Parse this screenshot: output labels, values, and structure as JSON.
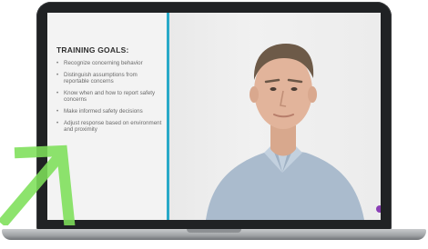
{
  "slide": {
    "title": "TRAINING GOALS:",
    "goals": [
      "Recognize concerning behavior",
      "Distinguish assumptions from reportable concerns",
      "Know when and how to report safety concerns",
      "Make informed safety decisions",
      "Adjust response based on environment and proximity"
    ]
  },
  "video": {
    "subject": "presenter"
  },
  "annotation": {
    "arrow_icon": "arrow-icon",
    "arrow_color": "#7ee05a"
  },
  "colors": {
    "divider": "#29a9c8",
    "laptop_frame": "#202224",
    "shirt": "#aabbcd",
    "marker": "#8a3fb5"
  }
}
